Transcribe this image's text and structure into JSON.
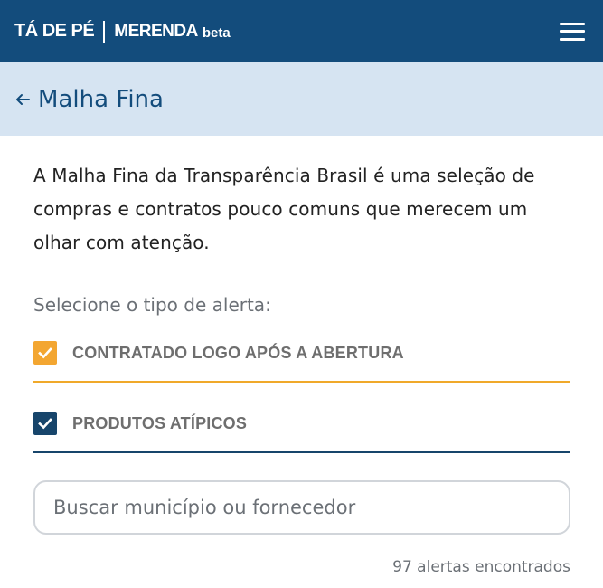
{
  "header": {
    "brand_part1": "TÁ DE PÉ",
    "brand_part2": "MERENDA",
    "brand_beta": "beta",
    "menu_icon": "hamburger-menu-icon"
  },
  "page": {
    "back_icon": "arrow-left-icon",
    "title": "Malha Fina"
  },
  "intro_text": "A Malha Fina da Transparência Brasil é uma seleção de compras e contratos pouco comuns que merecem um olhar com atenção.",
  "filters": {
    "label": "Selecione o tipo de alerta:",
    "items": [
      {
        "label": "CONTRATADO LOGO APÓS A ABERTURA",
        "checked": true,
        "color": "#f3a631"
      },
      {
        "label": "PRODUTOS ATÍPICOS",
        "checked": true,
        "color": "#17456b"
      }
    ]
  },
  "search": {
    "placeholder": "Buscar município ou fornecedor",
    "value": ""
  },
  "results_count": "97 alertas encontrados",
  "colors": {
    "header_bg": "#134c7c",
    "subheader_bg": "#d6e4f2",
    "accent_orange": "#f3a631",
    "accent_blue": "#17456b"
  }
}
